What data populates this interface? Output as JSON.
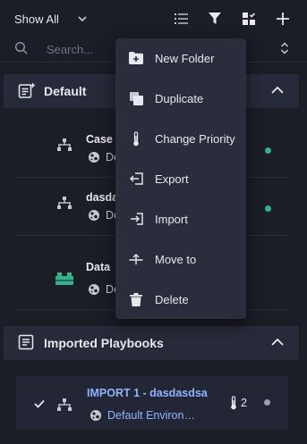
{
  "toolbar": {
    "filter_value": "Show All",
    "search_placeholder": "Search..."
  },
  "groups": [
    {
      "title": "Default",
      "items": [
        {
          "name": "Case I",
          "env": "Def",
          "status_color": "#2fb589"
        },
        {
          "name": "dasda",
          "env": "Def",
          "status_color": "#2fb589"
        },
        {
          "name": "Data",
          "env": "Def",
          "status_color": ""
        }
      ]
    },
    {
      "title": "Imported Playbooks",
      "items": [
        {
          "name": "IMPORT 1 - dasdasdsa",
          "env": "Default Environ…",
          "priority": "2",
          "status_color": "#9aa0b0",
          "selected": true
        }
      ]
    }
  ],
  "context_menu": {
    "items": [
      {
        "label": "New Folder",
        "icon": "folder-plus-icon"
      },
      {
        "label": "Duplicate",
        "icon": "duplicate-icon"
      },
      {
        "label": "Change Priority",
        "icon": "thermometer-icon"
      },
      {
        "label": "Export",
        "icon": "export-icon"
      },
      {
        "label": "Import",
        "icon": "import-icon"
      },
      {
        "label": "Move to",
        "icon": "move-icon"
      },
      {
        "label": "Delete",
        "icon": "trash-icon"
      }
    ]
  },
  "colors": {
    "background": "#1b1d27",
    "panel": "#272a38",
    "menu": "#2a2d3b",
    "accent_link": "#8fb4ff",
    "status_green": "#2fb589",
    "block_icon_green": "#2fb589"
  }
}
